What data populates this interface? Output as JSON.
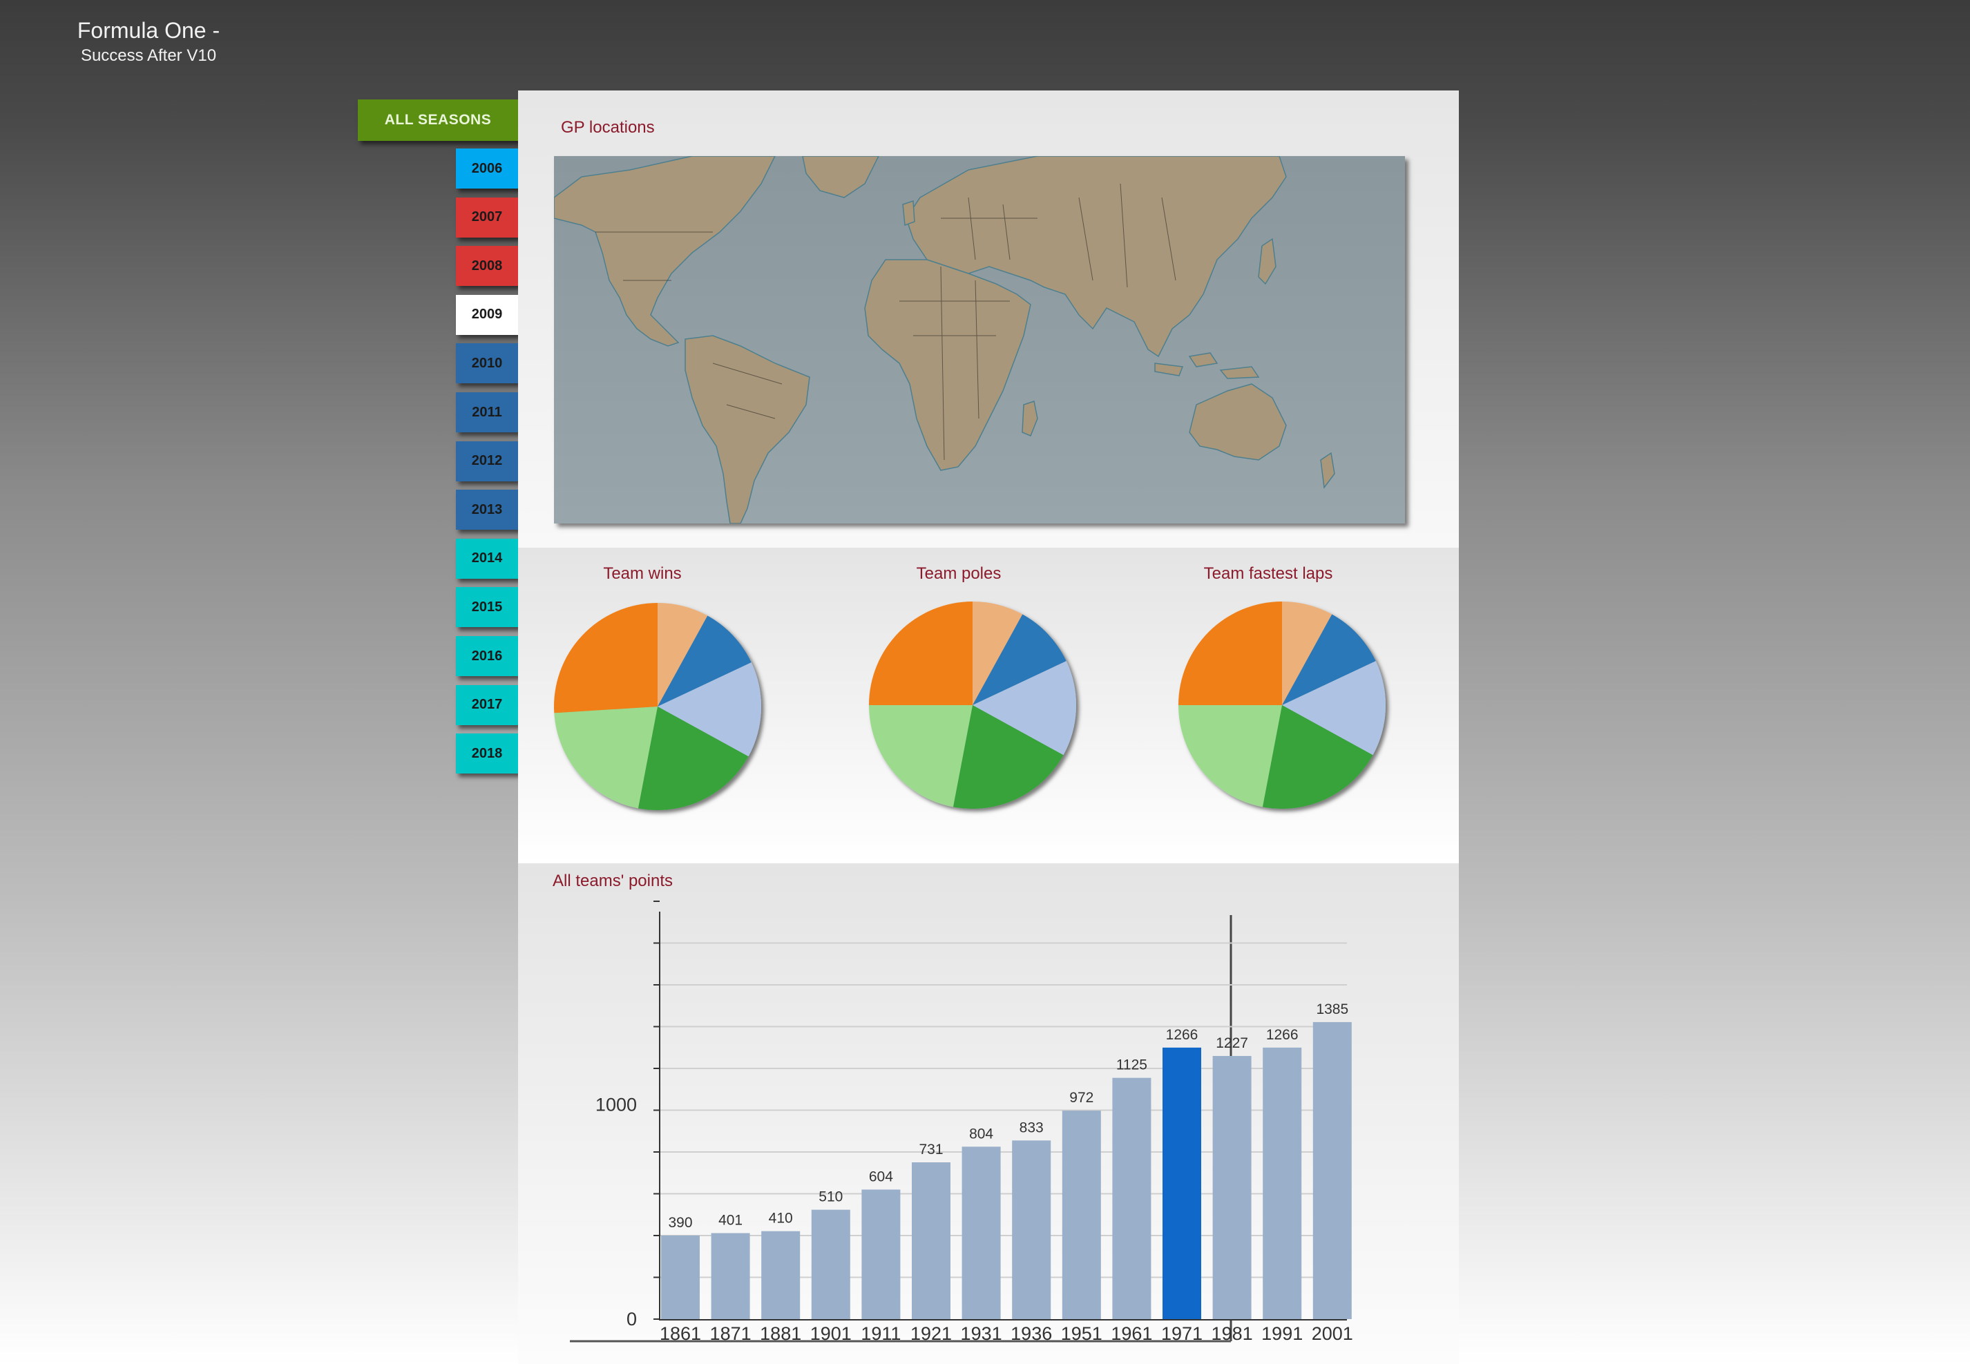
{
  "app": {
    "title_line1": "Formula One -",
    "title_line2": "Success After V10"
  },
  "nav": {
    "all_label": "ALL SEASONS",
    "seasons": [
      {
        "label": "2006",
        "color": "#00a8f0"
      },
      {
        "label": "2007",
        "color": "#d93636"
      },
      {
        "label": "2008",
        "color": "#d93636"
      },
      {
        "label": "2009",
        "color": "#ffffff"
      },
      {
        "label": "2010",
        "color": "#2b6aa6"
      },
      {
        "label": "2011",
        "color": "#2b6aa6"
      },
      {
        "label": "2012",
        "color": "#2b6aa6"
      },
      {
        "label": "2013",
        "color": "#2b6aa6"
      },
      {
        "label": "2014",
        "color": "#00c6c6"
      },
      {
        "label": "2015",
        "color": "#00c6c6"
      },
      {
        "label": "2016",
        "color": "#00c6c6"
      },
      {
        "label": "2017",
        "color": "#00c6c6"
      },
      {
        "label": "2018",
        "color": "#00c6c6"
      }
    ],
    "accent": "#5a8f12"
  },
  "map": {
    "title": "GP locations",
    "land_color": "#a8977a",
    "water_color": "#8f9da3"
  },
  "pies": {
    "colors": [
      "#ecb07a",
      "#2b78b8",
      "#aec3e3",
      "#38a23a",
      "#9cdb8e",
      "#ef7f17"
    ],
    "titles": [
      "Team wins",
      "Team poles",
      "Team fastest laps"
    ]
  },
  "chart_data": [
    {
      "type": "pie",
      "title": "Team wins",
      "values": [
        8,
        10,
        15,
        20,
        21,
        26
      ]
    },
    {
      "type": "pie",
      "title": "Team poles",
      "values": [
        8,
        10,
        15,
        20,
        22,
        25
      ]
    },
    {
      "type": "pie",
      "title": "Team fastest laps",
      "values": [
        8,
        10,
        15,
        20,
        22,
        25
      ]
    },
    {
      "type": "bar",
      "title": "All teams' points",
      "categories": [
        "1861",
        "1871",
        "1881",
        "1901",
        "1911",
        "1921",
        "1931",
        "1936",
        "1951",
        "1961",
        "1971",
        "1981",
        "1991",
        "2001"
      ],
      "values": [
        390,
        401,
        410,
        510,
        604,
        731,
        804,
        833,
        972,
        1125,
        1266,
        1227,
        1266,
        1385
      ],
      "highlight_index": 10,
      "ylim": [
        0,
        1900
      ],
      "yticks": [
        0,
        1000
      ],
      "grid": true,
      "bar_color": "#9aafc9",
      "highlight_color": "#1068c8"
    }
  ]
}
